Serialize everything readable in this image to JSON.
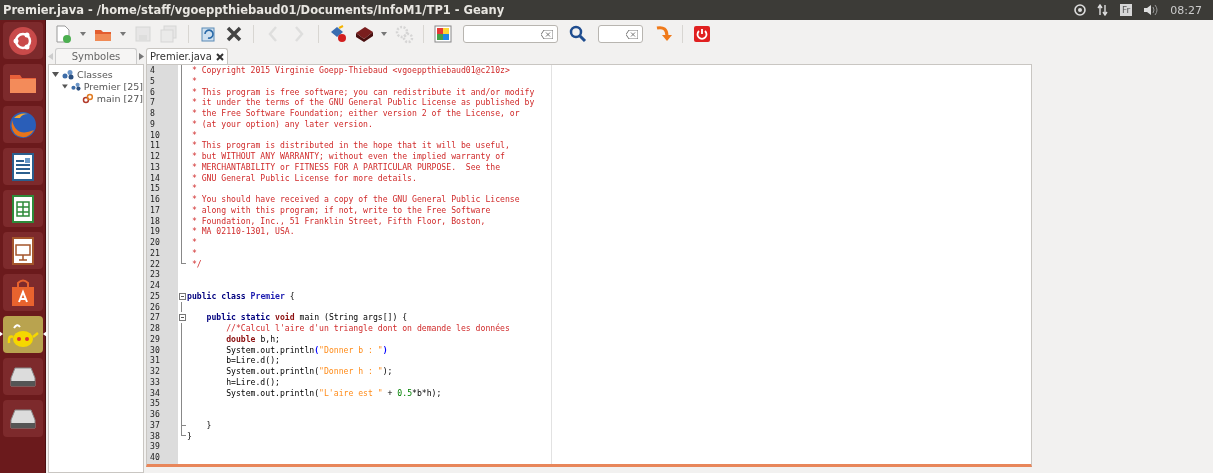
{
  "window": {
    "title": "Premier.java - /home/staff/vgoeppthiebaud01/Documents/InfoM1/TP1 - Geany"
  },
  "panel": {
    "indicators": [
      {
        "kind": "sync"
      },
      {
        "kind": "network"
      },
      {
        "kind": "keyboard",
        "label": "Fr"
      },
      {
        "kind": "volume"
      }
    ],
    "clock": "08:27"
  },
  "launcher": [
    {
      "kind": "dash",
      "focused": false
    },
    {
      "kind": "files",
      "focused": false
    },
    {
      "kind": "browser",
      "focused": false
    },
    {
      "kind": "writer",
      "focused": false
    },
    {
      "kind": "calc",
      "focused": false
    },
    {
      "kind": "impress",
      "focused": false
    },
    {
      "kind": "software",
      "focused": false
    },
    {
      "kind": "teapot",
      "focused": true
    },
    {
      "kind": "drive",
      "focused": false
    },
    {
      "kind": "drive",
      "focused": false
    }
  ],
  "toolbar": [
    {
      "kind": "new",
      "disabled": false
    },
    {
      "kind": "caret",
      "disabled": false
    },
    {
      "kind": "open",
      "disabled": false
    },
    {
      "kind": "caret",
      "disabled": false
    },
    {
      "kind": "save",
      "disabled": true
    },
    {
      "kind": "save-all",
      "disabled": true
    },
    {
      "kind": "sep"
    },
    {
      "kind": "reload",
      "disabled": false
    },
    {
      "kind": "close",
      "disabled": false
    },
    {
      "kind": "sep"
    },
    {
      "kind": "back",
      "disabled": true
    },
    {
      "kind": "forward",
      "disabled": true
    },
    {
      "kind": "sep"
    },
    {
      "kind": "compile",
      "disabled": false
    },
    {
      "kind": "build",
      "disabled": false
    },
    {
      "kind": "caret",
      "disabled": false
    },
    {
      "kind": "run",
      "disabled": true
    },
    {
      "kind": "sep"
    },
    {
      "kind": "color",
      "disabled": false
    },
    {
      "kind": "search-field"
    },
    {
      "kind": "search",
      "disabled": false
    },
    {
      "kind": "line-field"
    },
    {
      "kind": "jump",
      "disabled": false
    },
    {
      "kind": "sep"
    },
    {
      "kind": "quit",
      "disabled": false
    }
  ],
  "sidebar": {
    "tabs": [
      {
        "label": "Symboles",
        "selected": true
      }
    ],
    "tree": [
      {
        "label": "Classes",
        "kind": "group",
        "expanded": true,
        "children": [
          {
            "label": "Premier [25]",
            "kind": "class",
            "expanded": true,
            "children": [
              {
                "label": "main [27]",
                "kind": "method"
              }
            ]
          }
        ]
      }
    ]
  },
  "editor": {
    "tabs": [
      {
        "label": "Premier.java",
        "selected": true
      }
    ],
    "lines": [
      {
        "number": "4",
        "kind": "fold-line",
        "tokens": [
          {
            "kind": "comment",
            "text": " * Copyright 2015 Virginie Goepp-Thiebaud <vgoeppthiebaud01@c210z>"
          }
        ]
      },
      {
        "number": "5",
        "kind": "fold-line",
        "tokens": [
          {
            "kind": "comment",
            "text": " *"
          }
        ]
      },
      {
        "number": "6",
        "kind": "fold-line",
        "tokens": [
          {
            "kind": "comment",
            "text": " * This program is free software; you can redistribute it and/or modify"
          }
        ]
      },
      {
        "number": "7",
        "kind": "fold-line",
        "tokens": [
          {
            "kind": "comment",
            "text": " * it under the terms of the GNU General Public License as published by"
          }
        ]
      },
      {
        "number": "8",
        "kind": "fold-line",
        "tokens": [
          {
            "kind": "comment",
            "text": " * the Free Software Foundation; either version 2 of the License, or"
          }
        ]
      },
      {
        "number": "9",
        "kind": "fold-line",
        "tokens": [
          {
            "kind": "comment",
            "text": " * (at your option) any later version."
          }
        ]
      },
      {
        "number": "10",
        "kind": "fold-line",
        "tokens": [
          {
            "kind": "comment",
            "text": " *"
          }
        ]
      },
      {
        "number": "11",
        "kind": "fold-line",
        "tokens": [
          {
            "kind": "comment",
            "text": " * This program is distributed in the hope that it will be useful,"
          }
        ]
      },
      {
        "number": "12",
        "kind": "fold-line",
        "tokens": [
          {
            "kind": "comment",
            "text": " * but WITHOUT ANY WARRANTY; without even the implied warranty of"
          }
        ]
      },
      {
        "number": "13",
        "kind": "fold-line",
        "tokens": [
          {
            "kind": "comment",
            "text": " * MERCHANTABILITY or FITNESS FOR A PARTICULAR PURPOSE.  See the"
          }
        ]
      },
      {
        "number": "14",
        "kind": "fold-line",
        "tokens": [
          {
            "kind": "comment",
            "text": " * GNU General Public License for more details."
          }
        ]
      },
      {
        "number": "15",
        "kind": "fold-line",
        "tokens": [
          {
            "kind": "comment",
            "text": " *"
          }
        ]
      },
      {
        "number": "16",
        "kind": "fold-line",
        "tokens": [
          {
            "kind": "comment",
            "text": " * You should have received a copy of the GNU General Public License"
          }
        ]
      },
      {
        "number": "17",
        "kind": "fold-line",
        "tokens": [
          {
            "kind": "comment",
            "text": " * along with this program; if not, write to the Free Software"
          }
        ]
      },
      {
        "number": "18",
        "kind": "fold-line",
        "tokens": [
          {
            "kind": "comment",
            "text": " * Foundation, Inc., 51 Franklin Street, Fifth Floor, Boston,"
          }
        ]
      },
      {
        "number": "19",
        "kind": "fold-line",
        "tokens": [
          {
            "kind": "comment",
            "text": " * MA 02110-1301, USA."
          }
        ]
      },
      {
        "number": "20",
        "kind": "fold-line",
        "tokens": [
          {
            "kind": "comment",
            "text": " *"
          }
        ]
      },
      {
        "number": "21",
        "kind": "fold-line",
        "tokens": [
          {
            "kind": "comment",
            "text": " *"
          }
        ]
      },
      {
        "number": "22",
        "kind": "fold-end",
        "tokens": [
          {
            "kind": "comment",
            "text": " */"
          }
        ]
      },
      {
        "number": "23",
        "kind": "plain"
      },
      {
        "number": "24",
        "kind": "plain"
      },
      {
        "number": "25",
        "kind": "fold-start",
        "tokens": [
          {
            "kind": "keyword",
            "text": "public class "
          },
          {
            "kind": "classname",
            "text": "Premier"
          },
          {
            "kind": "plain",
            "text": " {"
          }
        ]
      },
      {
        "number": "26",
        "kind": "fold-line"
      },
      {
        "number": "27",
        "kind": "fold-start",
        "tokens": [
          {
            "kind": "keyword",
            "text": "    public static "
          },
          {
            "kind": "type",
            "text": "void"
          },
          {
            "kind": "plain",
            "text": " main (String args[]) {"
          }
        ]
      },
      {
        "number": "28",
        "kind": "fold-line",
        "tokens": [
          {
            "kind": "comment",
            "text": "        //*Calcul l'aire d'un triangle dont on demande les données"
          }
        ]
      },
      {
        "number": "29",
        "kind": "fold-line",
        "tokens": [
          {
            "kind": "type",
            "text": "        double"
          },
          {
            "kind": "plain",
            "text": " b,h;"
          }
        ]
      },
      {
        "number": "30",
        "kind": "fold-line",
        "tokens": [
          {
            "kind": "plain",
            "text": "        System.out.println"
          },
          {
            "kind": "brace",
            "text": "("
          },
          {
            "kind": "string",
            "text": "\"Donner b : \""
          },
          {
            "kind": "brace",
            "text": ")"
          }
        ]
      },
      {
        "number": "31",
        "kind": "fold-line",
        "tokens": [
          {
            "kind": "plain",
            "text": "        b=Lire.d();"
          }
        ]
      },
      {
        "number": "32",
        "kind": "fold-line",
        "tokens": [
          {
            "kind": "plain",
            "text": "        System.out.println("
          },
          {
            "kind": "string",
            "text": "\"Donner h : \""
          },
          {
            "kind": "plain",
            "text": ");"
          }
        ]
      },
      {
        "number": "33",
        "kind": "fold-line",
        "tokens": [
          {
            "kind": "plain",
            "text": "        h=Lire.d();"
          }
        ]
      },
      {
        "number": "34",
        "kind": "fold-line",
        "tokens": [
          {
            "kind": "plain",
            "text": "        System.out.println("
          },
          {
            "kind": "string",
            "text": "\"L'aire est \""
          },
          {
            "kind": "plain",
            "text": " + "
          },
          {
            "kind": "number",
            "text": "0.5"
          },
          {
            "kind": "plain",
            "text": "*b*h);"
          }
        ]
      },
      {
        "number": "35",
        "kind": "fold-line"
      },
      {
        "number": "36",
        "kind": "fold-line"
      },
      {
        "number": "37",
        "kind": "fold-mid",
        "tokens": [
          {
            "kind": "plain",
            "text": "    }"
          }
        ]
      },
      {
        "number": "38",
        "kind": "fold-end",
        "tokens": [
          {
            "kind": "plain",
            "text": "}"
          }
        ]
      },
      {
        "number": "39",
        "kind": "plain"
      },
      {
        "number": "40",
        "kind": "plain"
      }
    ]
  }
}
